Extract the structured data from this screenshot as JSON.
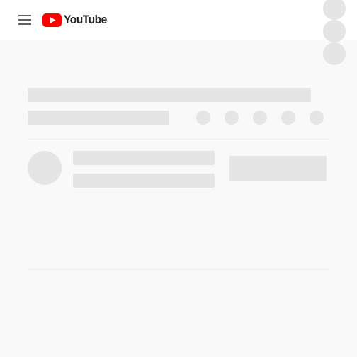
{
  "masthead": {
    "menu_icon": "hamburger-menu-icon",
    "logo": {
      "icon": "youtube-play-icon",
      "text": "YouTube",
      "accent_color": "#ff0000"
    },
    "right_button_icons": [
      "placeholder-circle-icon",
      "placeholder-circle-icon",
      "placeholder-circle-icon"
    ]
  },
  "skeleton": {
    "color": "#e5e5e5",
    "background": "#f9f9f9",
    "action_icons": [
      "placeholder-circle-icon",
      "placeholder-circle-icon",
      "placeholder-circle-icon",
      "placeholder-circle-icon",
      "placeholder-circle-icon"
    ]
  }
}
